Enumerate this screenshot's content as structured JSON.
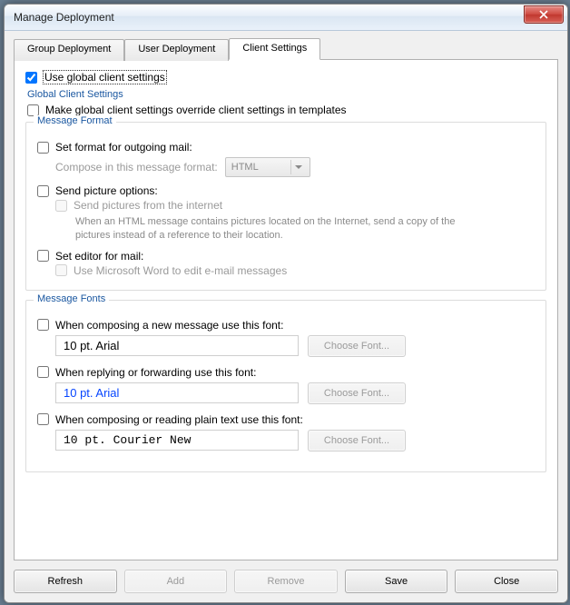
{
  "window": {
    "title": "Manage Deployment"
  },
  "tabs": {
    "group": "Group Deployment",
    "user": "User Deployment",
    "client": "Client Settings"
  },
  "top": {
    "use_global": "Use global client settings",
    "section": "Global Client Settings",
    "override": "Make global client settings override client settings in templates"
  },
  "format": {
    "legend": "Message Format",
    "set_format": "Set format for outgoing mail:",
    "compose_label": "Compose in this message format:",
    "compose_value": "HTML",
    "send_opts": "Send picture options:",
    "send_internet": "Send pictures from the internet",
    "send_help": "When an HTML message contains pictures located on the Internet, send a copy of the pictures instead of a reference to their location.",
    "set_editor": "Set editor for mail:",
    "use_word": "Use Microsoft Word to edit e-mail messages"
  },
  "fonts": {
    "legend": "Message Fonts",
    "compose": "When composing a new message use this font:",
    "reply": "When replying or forwarding use this font:",
    "plain": "When composing or reading plain text use this font:",
    "sample_arial": "10 pt. Arial",
    "sample_courier": "10 pt. Courier New",
    "choose": "Choose Font..."
  },
  "buttons": {
    "refresh": "Refresh",
    "add": "Add",
    "remove": "Remove",
    "save": "Save",
    "close": "Close"
  }
}
